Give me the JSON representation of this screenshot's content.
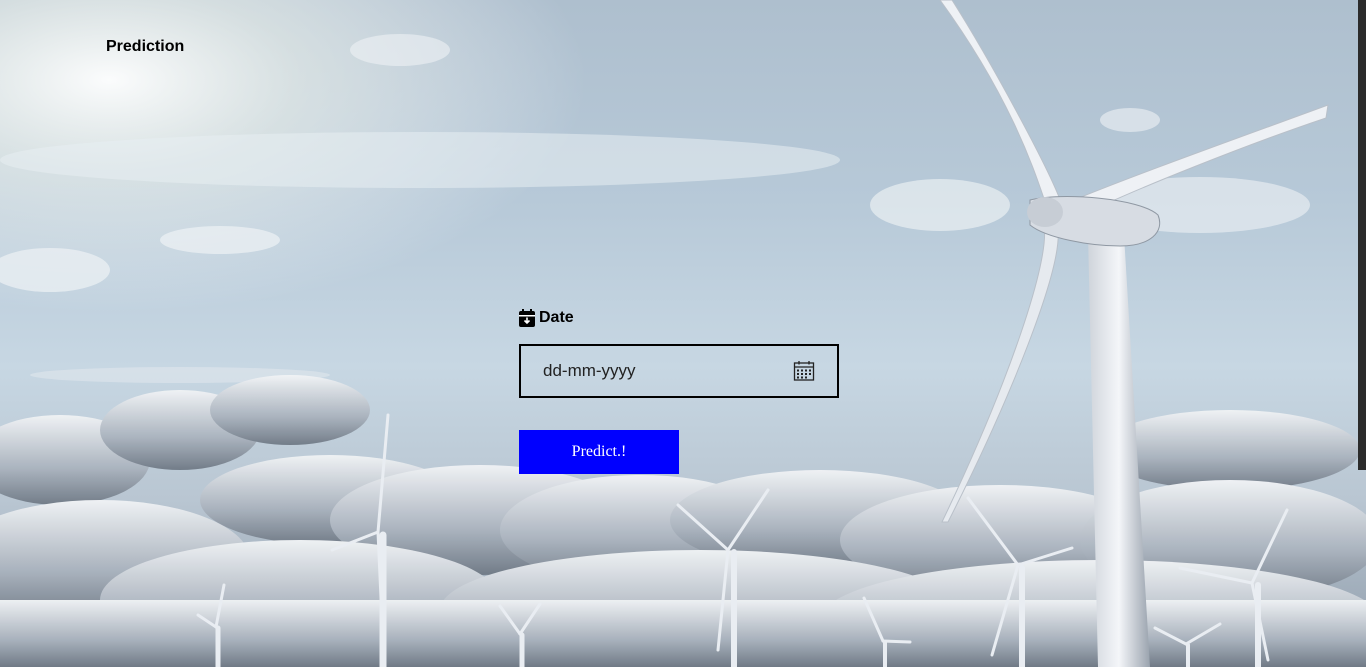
{
  "nav": {
    "title": "Prediction"
  },
  "form": {
    "date_label": "Date",
    "date_placeholder": "dd-mm-yyyy",
    "date_icon": "calendar-icon",
    "label_icon": "calendar-download-icon",
    "predict_label": "Predict.!"
  },
  "colors": {
    "button_bg": "#0000ff",
    "button_text": "#ffffff",
    "sky": "#b7c9d8"
  },
  "background": {
    "scene": "wind-turbines-in-cloudy-sky"
  }
}
